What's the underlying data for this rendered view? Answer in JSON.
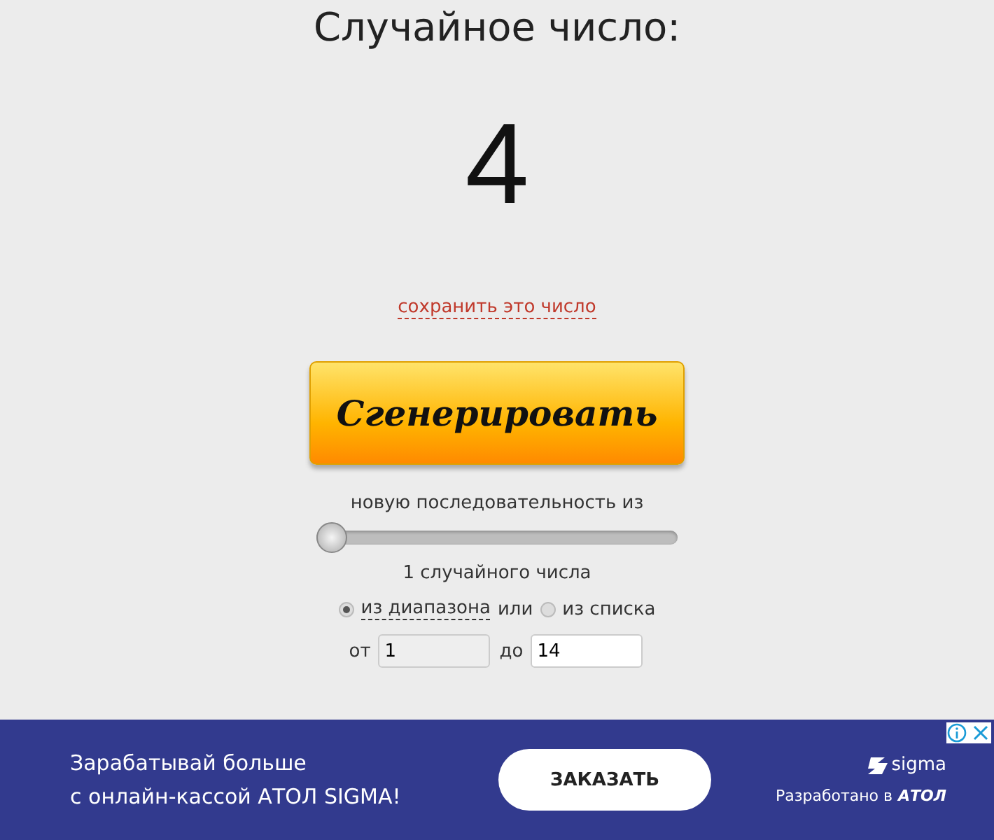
{
  "title": "Случайное число:",
  "result": "4",
  "save_link": "сохранить это число",
  "generate_button": "Сгенерировать",
  "sequence_label": "новую последовательность из",
  "count_slider": {
    "level": 0
  },
  "count_label": "1 случайного числа",
  "modes": [
    {
      "label": "из диапазона",
      "selected": true,
      "dashed": true
    },
    {
      "label": "из списка",
      "selected": false,
      "dashed": false
    }
  ],
  "modes_connector": "или",
  "range": {
    "from_label": "от",
    "from_value": "1",
    "to_label": "до",
    "to_value": "14"
  },
  "ad": {
    "text_line_1": "Зарабатывай больше",
    "text_line_2": "с онлайн-кассой АТОЛ SIGMA!",
    "button": "ЗАКАЗАТЬ",
    "brand": "sigma",
    "credit": "Разработано в",
    "credit_brand": "АТОЛ"
  }
}
